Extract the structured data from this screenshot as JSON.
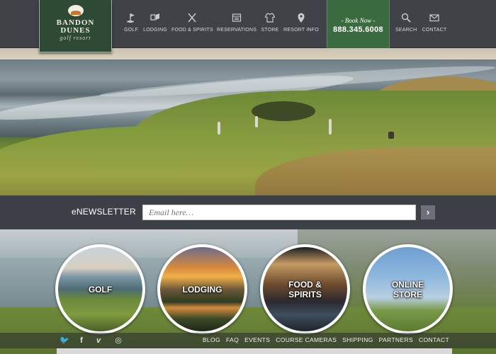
{
  "brand": {
    "name_line1": "BANDON",
    "name_line2": "DUNES",
    "tagline": "golf resort"
  },
  "nav": {
    "items": [
      {
        "label": "GOLF",
        "icon": "golf-flag-icon"
      },
      {
        "label": "LODGING",
        "icon": "lodging-icon"
      },
      {
        "label": "FOOD & SPIRITS",
        "icon": "fork-knife-icon"
      },
      {
        "label": "RESERVATIONS",
        "icon": "calendar-icon"
      },
      {
        "label": "STORE",
        "icon": "shirt-icon"
      },
      {
        "label": "RESORT INFO",
        "icon": "map-pin-icon"
      }
    ],
    "book_now": {
      "label": "- Book Now -",
      "phone": "888.345.6008"
    },
    "search_label": "SEARCH",
    "contact_label": "CONTACT"
  },
  "newsletter": {
    "label": "eNEWSLETTER",
    "placeholder": "Email here…",
    "submit": "›"
  },
  "features": [
    {
      "label": "GOLF"
    },
    {
      "label": "LODGING"
    },
    {
      "label_line1": "FOOD &",
      "label_line2": "SPIRITS"
    },
    {
      "label_line1": "ONLINE",
      "label_line2": "STORE"
    }
  ],
  "social": [
    {
      "icon": "twitter-icon",
      "glyph": "🐦"
    },
    {
      "icon": "facebook-icon",
      "glyph": "f"
    },
    {
      "icon": "vimeo-icon",
      "glyph": "v"
    },
    {
      "icon": "instagram-icon",
      "glyph": "◎"
    }
  ],
  "footer_links": [
    "BLOG",
    "FAQ",
    "EVENTS",
    "COURSE CAMERAS",
    "SHIPPING",
    "PARTNERS",
    "CONTACT"
  ],
  "colors": {
    "header": "#3f4247",
    "book_now_bg": "#3a6b3f",
    "logo_bg": "#2f4a34"
  }
}
